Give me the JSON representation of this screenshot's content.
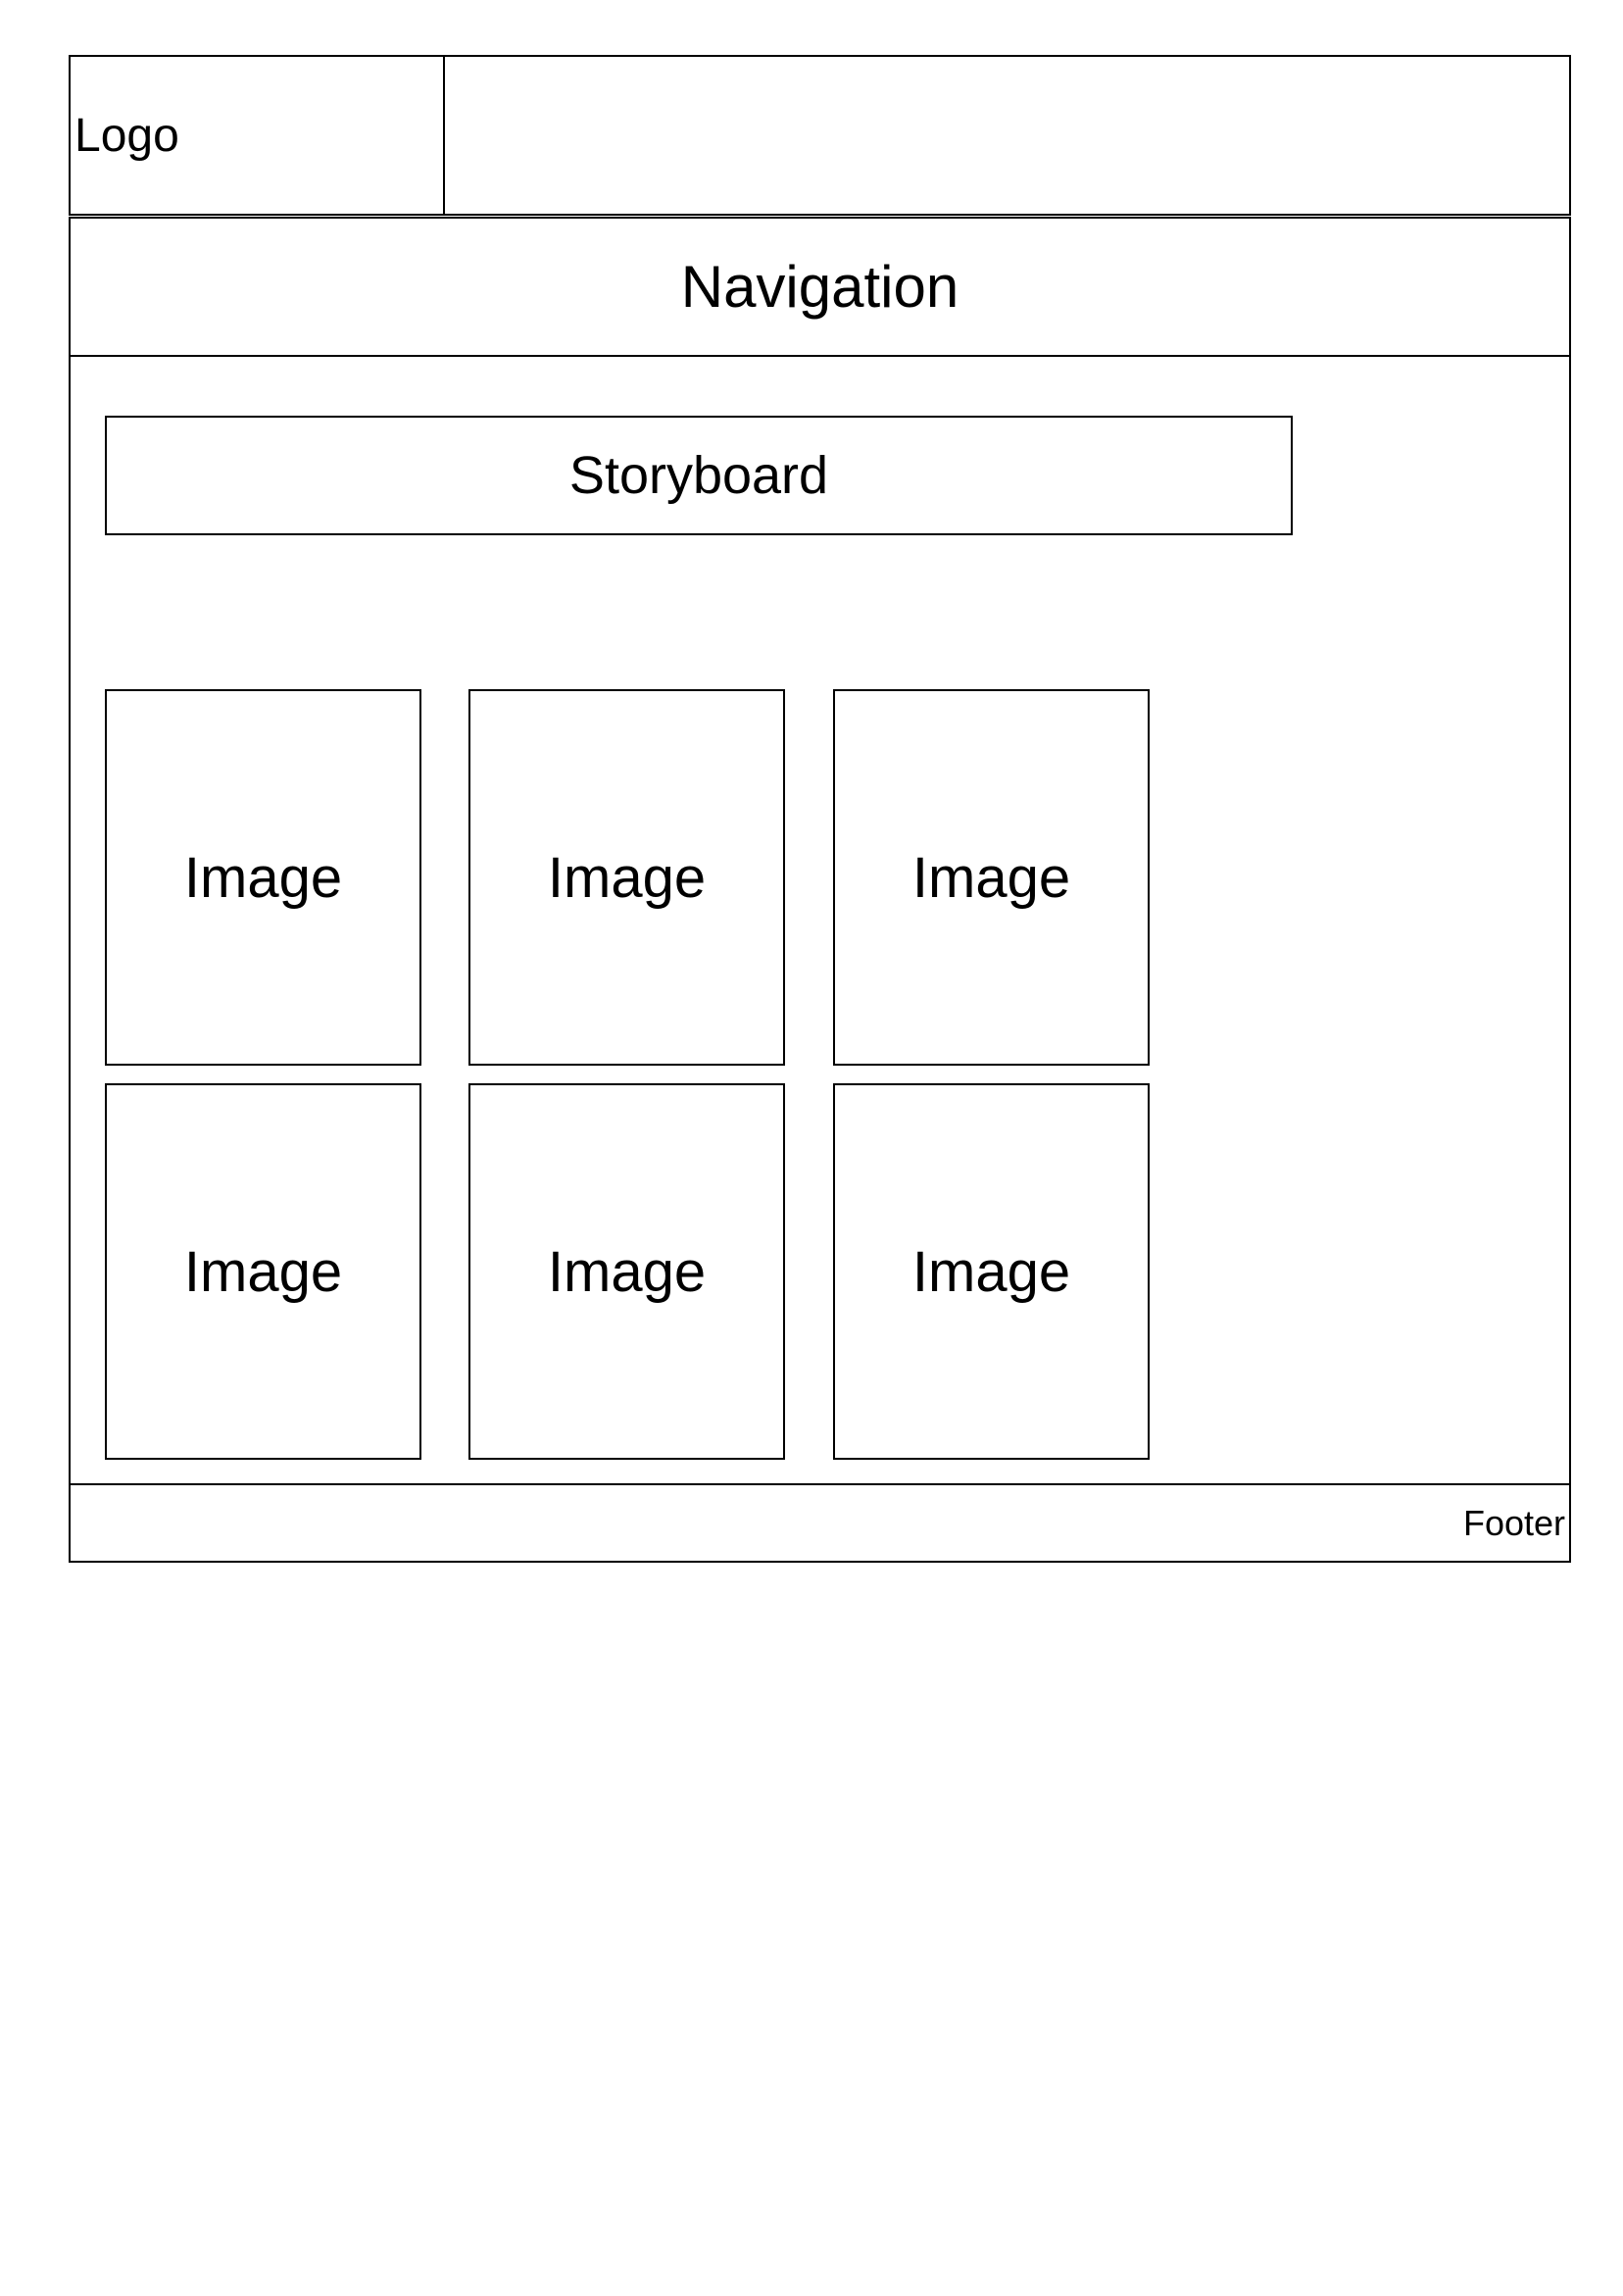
{
  "header": {
    "logo_label": "Logo"
  },
  "navigation": {
    "label": "Navigation"
  },
  "storyboard": {
    "label": "Storyboard"
  },
  "image_grid": {
    "tiles": [
      {
        "label": "Image"
      },
      {
        "label": "Image"
      },
      {
        "label": "Image"
      },
      {
        "label": "Image"
      },
      {
        "label": "Image"
      },
      {
        "label": "Image"
      }
    ]
  },
  "footer": {
    "label": "Footer"
  }
}
